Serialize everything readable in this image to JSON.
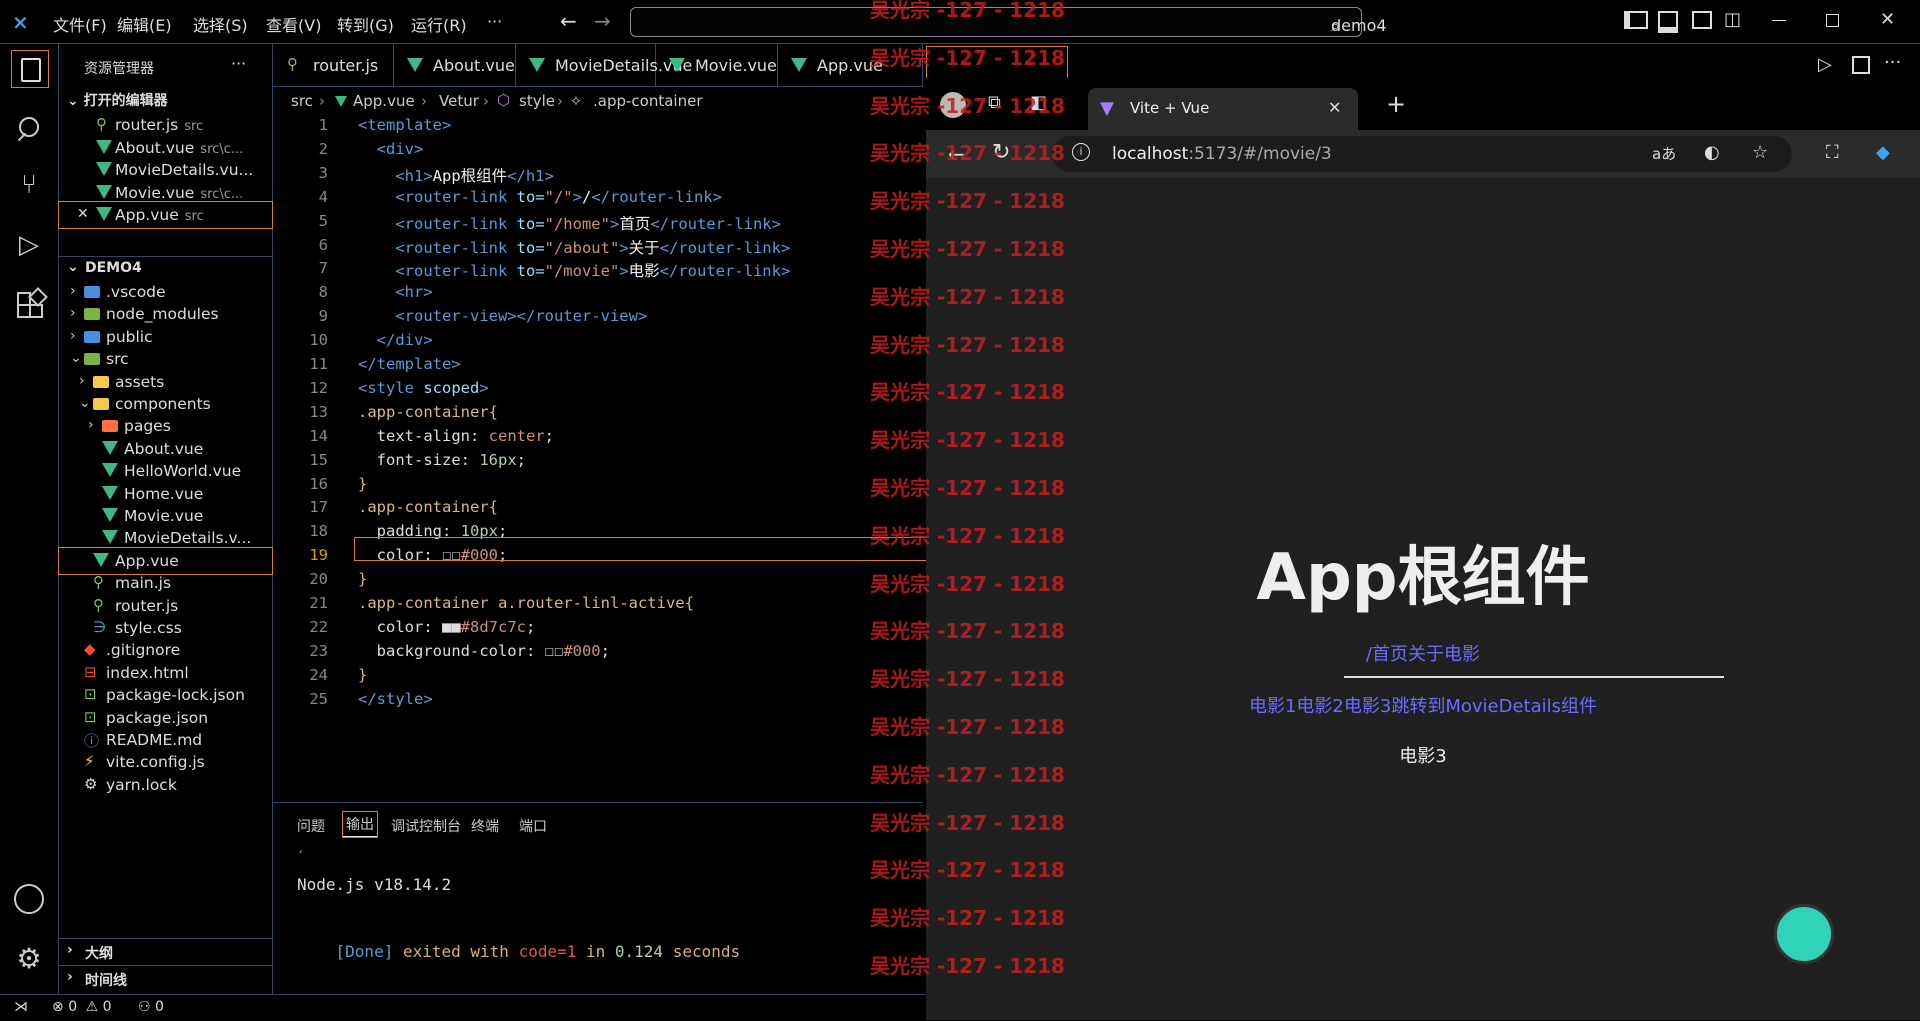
{
  "titlebar": {
    "menus": [
      "文件(F)",
      "编辑(E)",
      "选择(S)",
      "查看(V)",
      "转到(G)",
      "运行(R)",
      "···"
    ],
    "search": "demo4"
  },
  "sidebar": {
    "title": "资源管理器",
    "more": "···",
    "open_editors_label": "打开的编辑器",
    "open_editors": [
      {
        "name": "router.js",
        "path": "src",
        "kind": "js"
      },
      {
        "name": "About.vue",
        "path": "src\\c...",
        "kind": "vue"
      },
      {
        "name": "MovieDetails.vu...",
        "path": "",
        "kind": "vue"
      },
      {
        "name": "Movie.vue",
        "path": "src\\c...",
        "kind": "vue"
      },
      {
        "name": "App.vue",
        "path": "src",
        "kind": "vue",
        "close": "✕"
      }
    ],
    "project_label": "DEMO4",
    "tree": [
      {
        "name": ".vscode",
        "indent": 1,
        "kind": "folder-blue",
        "chev": "›"
      },
      {
        "name": "node_modules",
        "indent": 1,
        "kind": "folder-green",
        "chev": "›"
      },
      {
        "name": "public",
        "indent": 1,
        "kind": "folder-blue",
        "chev": "›"
      },
      {
        "name": "src",
        "indent": 1,
        "kind": "folder-green",
        "chev": "⌄"
      },
      {
        "name": "assets",
        "indent": 2,
        "kind": "folder-yellow",
        "chev": "›"
      },
      {
        "name": "components",
        "indent": 2,
        "kind": "folder-yellow",
        "chev": "⌄"
      },
      {
        "name": "pages",
        "indent": 3,
        "kind": "folder-red",
        "chev": "›"
      },
      {
        "name": "About.vue",
        "indent": 3,
        "kind": "vue",
        "chev": ""
      },
      {
        "name": "HelloWorld.vue",
        "indent": 3,
        "kind": "vue",
        "chev": ""
      },
      {
        "name": "Home.vue",
        "indent": 3,
        "kind": "vue",
        "chev": ""
      },
      {
        "name": "Movie.vue",
        "indent": 3,
        "kind": "vue",
        "chev": ""
      },
      {
        "name": "MovieDetails.v...",
        "indent": 3,
        "kind": "vue",
        "chev": ""
      },
      {
        "name": "App.vue",
        "indent": 2,
        "kind": "vue",
        "chev": ""
      },
      {
        "name": "main.js",
        "indent": 2,
        "kind": "js",
        "chev": ""
      },
      {
        "name": "router.js",
        "indent": 2,
        "kind": "js",
        "chev": ""
      },
      {
        "name": "style.css",
        "indent": 2,
        "kind": "css",
        "chev": ""
      },
      {
        "name": ".gitignore",
        "indent": 1,
        "kind": "git",
        "chev": ""
      },
      {
        "name": "index.html",
        "indent": 1,
        "kind": "html",
        "chev": ""
      },
      {
        "name": "package-lock.json",
        "indent": 1,
        "kind": "json",
        "chev": ""
      },
      {
        "name": "package.json",
        "indent": 1,
        "kind": "json",
        "chev": ""
      },
      {
        "name": "README.md",
        "indent": 1,
        "kind": "info",
        "chev": ""
      },
      {
        "name": "vite.config.js",
        "indent": 1,
        "kind": "vite",
        "chev": ""
      },
      {
        "name": "yarn.lock",
        "indent": 1,
        "kind": "yarn",
        "chev": ""
      }
    ],
    "outline_label": "大纲",
    "timeline_label": "时间线"
  },
  "tabs": [
    "router.js",
    "About.vue",
    "MovieDetails.vue",
    "Movie.vue",
    "App.vue"
  ],
  "breadcrumb": [
    "src",
    "App.vue",
    "Vetur",
    "style",
    ".app-container"
  ],
  "code": [
    [
      [
        "tag",
        "<template>"
      ]
    ],
    [
      [
        "tag",
        "  <div>"
      ]
    ],
    [
      [
        "tag",
        "    <h1>"
      ],
      [
        "txt",
        "App根组件"
      ],
      [
        "tag",
        "</h1>"
      ]
    ],
    [
      [
        "tag",
        "    <router-link "
      ],
      [
        "attr",
        "to="
      ],
      [
        "str",
        "\"/\""
      ],
      [
        "tag",
        ">"
      ],
      [
        "txt",
        "/"
      ],
      [
        "tag",
        "</router-link>"
      ]
    ],
    [
      [
        "tag",
        "    <router-link "
      ],
      [
        "attr",
        "to="
      ],
      [
        "str",
        "\"/home\""
      ],
      [
        "tag",
        ">"
      ],
      [
        "txt",
        "首页"
      ],
      [
        "tag",
        "</router-link>"
      ]
    ],
    [
      [
        "tag",
        "    <router-link "
      ],
      [
        "attr",
        "to="
      ],
      [
        "str",
        "\"/about\""
      ],
      [
        "tag",
        ">"
      ],
      [
        "txt",
        "关于"
      ],
      [
        "tag",
        "</router-link>"
      ]
    ],
    [
      [
        "tag",
        "    <router-link "
      ],
      [
        "attr",
        "to="
      ],
      [
        "str",
        "\"/movie\""
      ],
      [
        "tag",
        ">"
      ],
      [
        "txt",
        "电影"
      ],
      [
        "tag",
        "</router-link>"
      ]
    ],
    [
      [
        "tag",
        "    <hr>"
      ]
    ],
    [
      [
        "tag",
        "    <router-view></router-view>"
      ]
    ],
    [
      [
        "tag",
        "  </div>"
      ]
    ],
    [
      [
        "tag",
        "</template>"
      ]
    ],
    [
      [
        "tag",
        "<style "
      ],
      [
        "attr",
        "scoped"
      ],
      [
        "tag",
        ">"
      ]
    ],
    [
      [
        "sel2",
        ".app-container{"
      ]
    ],
    [
      [
        "prop",
        "  text-align: "
      ],
      [
        "val",
        "center"
      ],
      [
        "prop",
        ";"
      ]
    ],
    [
      [
        "prop",
        "  font-size: "
      ],
      [
        "num",
        "16px"
      ],
      [
        "prop",
        ";"
      ]
    ],
    [
      [
        "sel2",
        "}"
      ]
    ],
    [
      [
        "sel2",
        ".app-container{"
      ]
    ],
    [
      [
        "prop",
        "  padding: "
      ],
      [
        "num",
        "10px"
      ],
      [
        "prop",
        ";"
      ]
    ],
    [
      [
        "prop",
        "  color: ☐☐"
      ],
      [
        "val",
        "#000"
      ],
      [
        "prop",
        ";"
      ]
    ],
    [
      [
        "sel2",
        "}"
      ]
    ],
    [
      [
        "sel2",
        ".app-container a.router-linl-active{"
      ]
    ],
    [
      [
        "prop",
        "  color: ■■"
      ],
      [
        "val",
        "#8d7c7c"
      ],
      [
        "prop",
        ";"
      ]
    ],
    [
      [
        "prop",
        "  background-color: ☐☐"
      ],
      [
        "val",
        "#000"
      ],
      [
        "prop",
        ";"
      ]
    ],
    [
      [
        "sel2",
        "}"
      ]
    ],
    [
      [
        "tag",
        "</style>"
      ]
    ]
  ],
  "panel": {
    "tabs": [
      "问题",
      "输出",
      "调试控制台",
      "终端",
      "端口"
    ],
    "active": "输出",
    "line1": "Node.js v18.14.2",
    "done": "[Done]",
    "exited": " exited with ",
    "code": "code=1",
    "in": " in ",
    "secs": "0.124",
    "seconds": " seconds"
  },
  "status": {
    "errors": "0",
    "warnings": "0",
    "ports": "0"
  },
  "browser": {
    "tab_title": "Vite + Vue",
    "url_host": "localhost",
    "url_rest": ":5173/#/movie/3",
    "heading": "App根组件",
    "links": "/首页关于电影",
    "movie_links": "电影1电影2电影3跳转到MovieDetails组件",
    "current": "电影3"
  },
  "watermark": "吴光宗 -127 - 1218",
  "colors": {
    "accent": "#d9822b",
    "link": "#6b6bff",
    "vue": "#41b883",
    "watermark": "#c81e1e"
  }
}
